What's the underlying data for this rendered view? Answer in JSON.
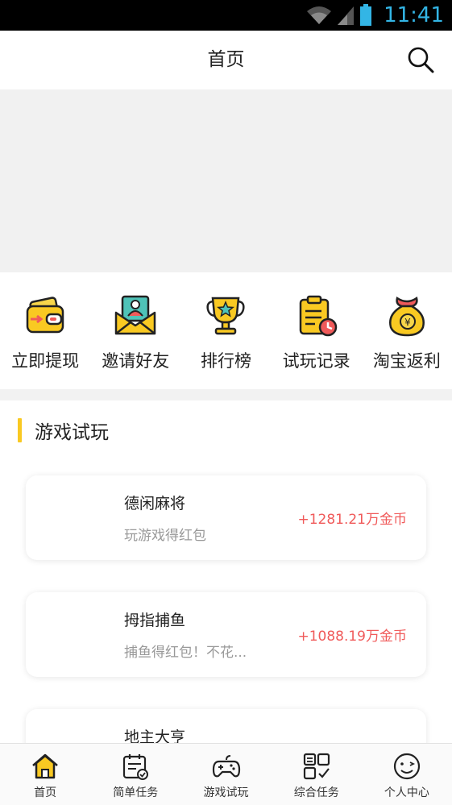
{
  "status_bar": {
    "time": "11:41",
    "icons": [
      "wifi-icon",
      "signal-icon",
      "battery-icon"
    ]
  },
  "header": {
    "title": "首页",
    "search_icon": "search-icon"
  },
  "quick_menu": [
    {
      "label": "立即提现",
      "icon": "wallet-icon"
    },
    {
      "label": "邀请好友",
      "icon": "invite-envelope-icon"
    },
    {
      "label": "排行榜",
      "icon": "trophy-icon"
    },
    {
      "label": "试玩记录",
      "icon": "clipboard-clock-icon"
    },
    {
      "label": "淘宝返利",
      "icon": "money-bag-icon"
    }
  ],
  "section": {
    "title": "游戏试玩"
  },
  "games": [
    {
      "name": "德闲麻将",
      "desc": "玩游戏得红包",
      "reward": "+1281.21万金币"
    },
    {
      "name": "拇指捕鱼",
      "desc": "捕鱼得红包！不花...",
      "reward": "+1088.19万金币"
    },
    {
      "name": "地主大亨",
      "desc": "",
      "reward": ""
    }
  ],
  "tab_bar": [
    {
      "label": "首页",
      "icon": "home-icon",
      "active": true
    },
    {
      "label": "简单任务",
      "icon": "calendar-task-icon"
    },
    {
      "label": "游戏试玩",
      "icon": "gamepad-icon"
    },
    {
      "label": "综合任务",
      "icon": "grid-check-icon"
    },
    {
      "label": "个人中心",
      "icon": "smiley-face-icon"
    }
  ],
  "colors": {
    "accent_yellow": "#f9c922",
    "reward_red": "#f05a5a",
    "status_blue": "#33b5e5"
  }
}
